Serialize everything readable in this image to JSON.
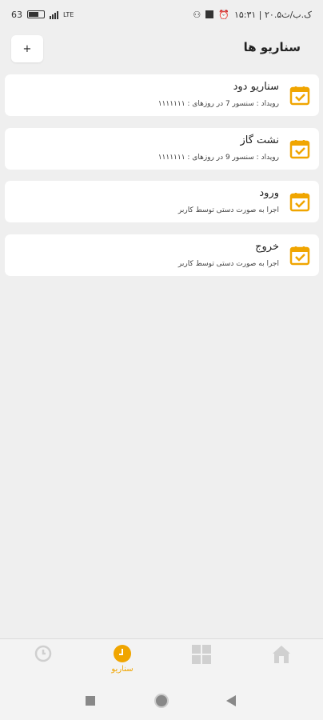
{
  "status_bar": {
    "time_text": "۱۵:۳۱ | ۲۰.۵ک.ب/ث",
    "battery_text": "63",
    "net_text": "LTE"
  },
  "header": {
    "title": "سناریو ها",
    "add_label": "+"
  },
  "scenarios": [
    {
      "title": "سناریو دود",
      "subtitle": "رویداد : سنسور 7 در روزهای : ۱۱۱۱۱۱۱"
    },
    {
      "title": "نشت گاز",
      "subtitle": "رویداد : سنسور 9 در روزهای : ۱۱۱۱۱۱۱"
    },
    {
      "title": "ورود",
      "subtitle": "اجرا به صورت دستی توسط کاربر"
    },
    {
      "title": "خروج",
      "subtitle": "اجرا به صورت دستی توسط کاربر"
    }
  ],
  "bottom_nav": {
    "active_label": "سناریو",
    "items": [
      "settings-icon",
      "scenario-icon",
      "dashboard-icon",
      "home-icon"
    ],
    "accent": "#f0a500"
  },
  "colors": {
    "accent": "#f0a500",
    "background": "#efefef"
  }
}
